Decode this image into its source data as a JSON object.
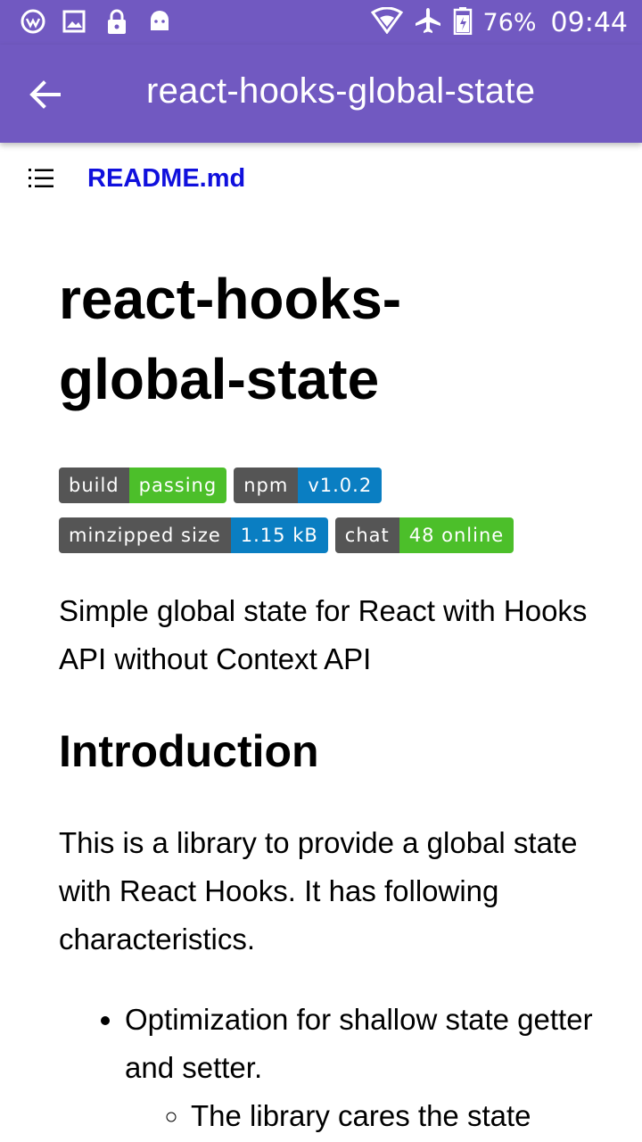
{
  "status_bar": {
    "battery_percent": "76%",
    "time": "09:44",
    "icons": [
      "vpn-icon",
      "image-icon",
      "lock-icon",
      "android-icon",
      "wifi-icon",
      "airplane-icon",
      "battery-icon"
    ]
  },
  "app_bar": {
    "title": "react-hooks-global-state",
    "back_icon": "arrow-left-icon"
  },
  "file_bar": {
    "toc_icon": "list-icon",
    "file_name": "README.md"
  },
  "readme": {
    "heading": "react-hooks-global-state",
    "badges": [
      {
        "label": "build",
        "value": "passing",
        "color": "#4c1"
      },
      {
        "label": "npm",
        "value": "v1.0.2",
        "color": "#007ec6"
      },
      {
        "label": "minzipped size",
        "value": "1.15 kB",
        "color": "#007ec6"
      },
      {
        "label": "chat",
        "value": "48 online",
        "color": "#4c1"
      }
    ],
    "lead": "Simple global state for React with Hooks API without Context API",
    "section_title": "Introduction",
    "intro_text": "This is a library to provide a global state with React Hooks. It has following characteristics.",
    "bullets": [
      {
        "text": "Optimization for shallow state getter and setter.",
        "sub": [
          "The library cares the state"
        ]
      }
    ]
  },
  "colors": {
    "accent": "#7159c1",
    "link": "#1010dd"
  }
}
